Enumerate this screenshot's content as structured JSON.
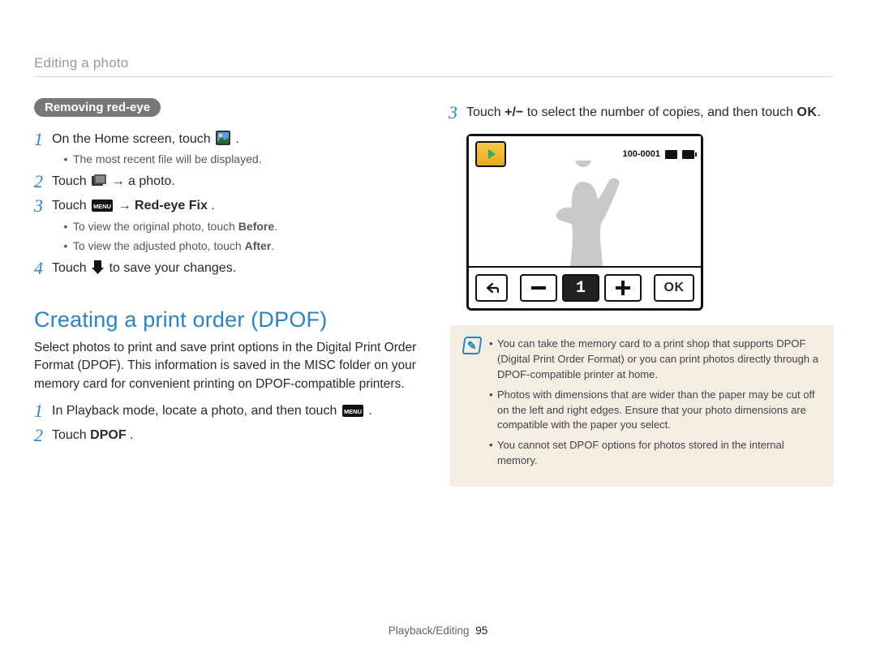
{
  "header": "Editing a photo",
  "left": {
    "pill": "Removing red-eye",
    "s1a": "On the Home screen, touch ",
    "s1b": ".",
    "s1_sub": "The most recent file will be displayed.",
    "s2a": "Touch ",
    "s2b": " → a photo.",
    "s3a": "Touch ",
    "s3b": " → ",
    "s3c": "Red-eye Fix",
    "s3d": ".",
    "s3_sub1a": "To view the original photo, touch ",
    "s3_sub1b": "Before",
    "s3_sub1c": ".",
    "s3_sub2a": "To view the adjusted photo, touch ",
    "s3_sub2b": "After",
    "s3_sub2c": ".",
    "s4a": "Touch ",
    "s4b": " to save your changes.",
    "h2": "Creating a print order (DPOF)",
    "para": "Select photos to print and save print options in the Digital Print Order Format (DPOF). This information is saved in the MISC folder on your memory card for convenient printing on DPOF-compatible printers.",
    "d1a": "In Playback mode, locate a photo, and then touch ",
    "d1b": ".",
    "d2a": "Touch ",
    "d2b": "DPOF",
    "d2c": "."
  },
  "right": {
    "s3a": "Touch ",
    "s3pm": "+/−",
    "s3b": " to select the number of copies, and then touch ",
    "s3ok": "OK",
    "s3c": ".",
    "cam": {
      "file_no": "100-0001",
      "count": "1",
      "ok": "OK"
    },
    "note1": "You can take the memory card to a print shop that supports DPOF (Digital Print Order Format) or you can print photos directly through a DPOF-compatible printer at home.",
    "note2": "Photos with dimensions that are wider than the paper may be cut off on the left and right edges. Ensure that your photo dimensions are compatible with the paper you select.",
    "note3": "You cannot set DPOF options for photos stored in the internal memory."
  },
  "footer": {
    "section": "Playback/Editing",
    "page": "95"
  },
  "nums": {
    "n1": "1",
    "n2": "2",
    "n3": "3",
    "n4": "4"
  },
  "icons": {
    "menu_label": "MENU"
  }
}
